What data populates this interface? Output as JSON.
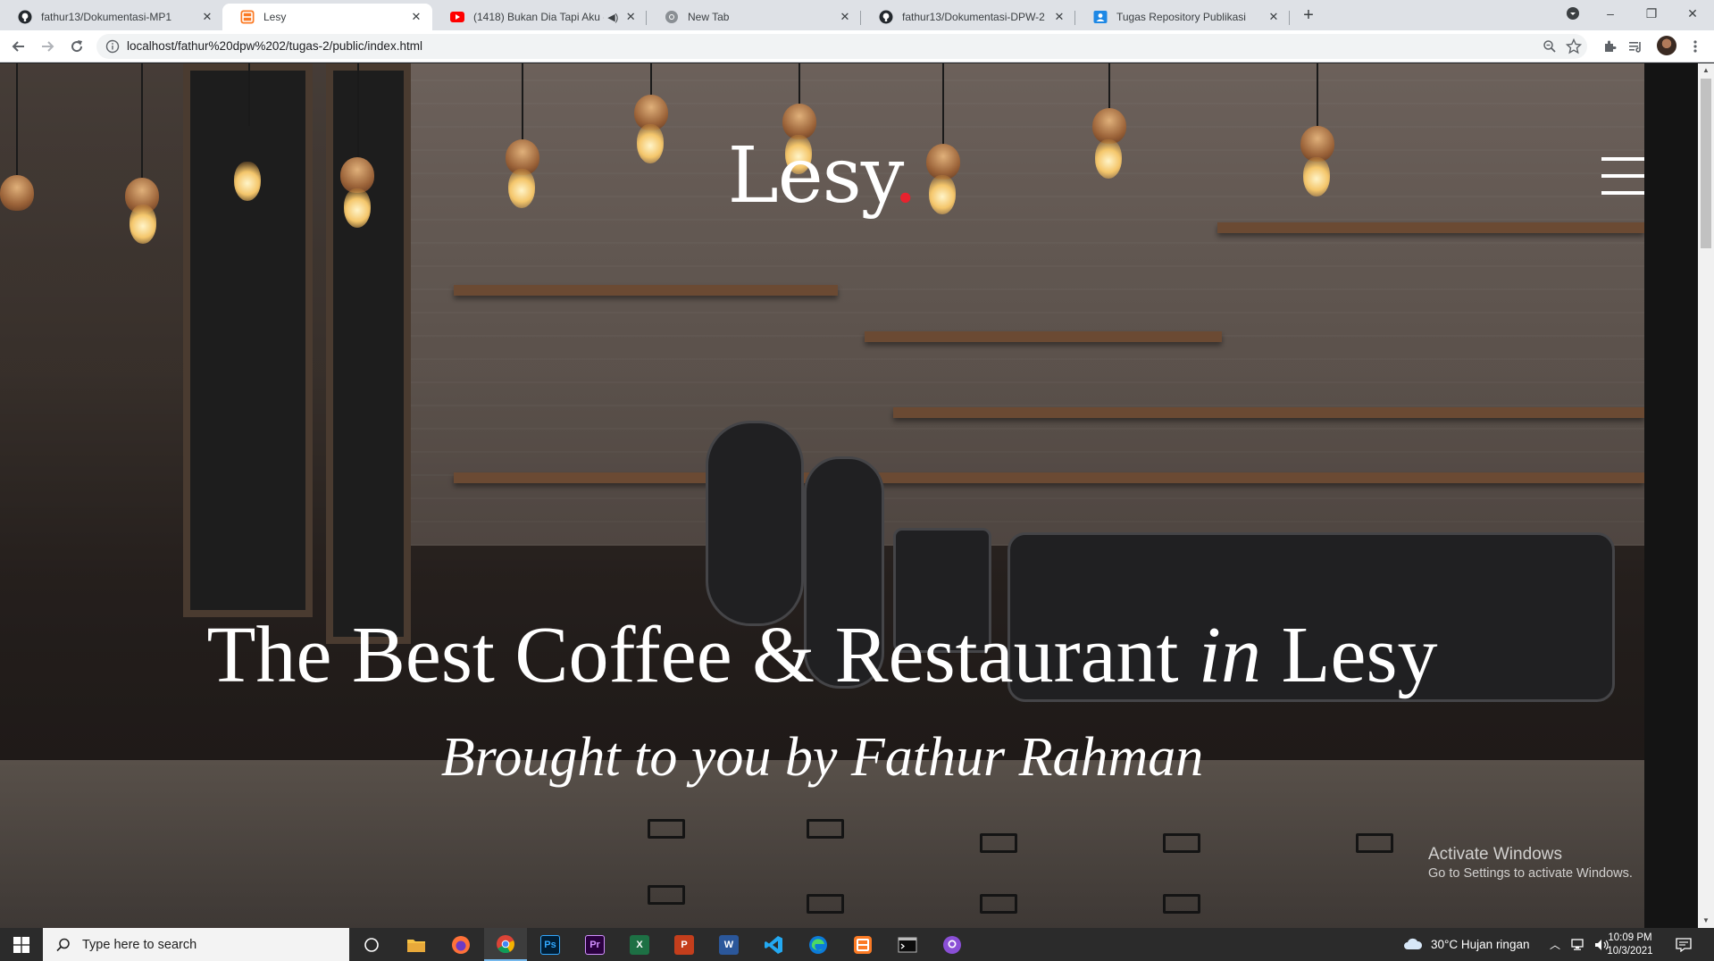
{
  "browser": {
    "tabs": [
      {
        "title": "fathur13/Dokumentasi-MP1",
        "icon": "github-icon",
        "active": false
      },
      {
        "title": "Lesy",
        "icon": "site-favicon-icon",
        "active": true
      },
      {
        "title": "(1418) Bukan Dia Tapi Aku -",
        "icon": "youtube-icon",
        "active": false,
        "audio": true
      },
      {
        "title": "New Tab",
        "icon": "chrome-icon",
        "active": false
      },
      {
        "title": "fathur13/Dokumentasi-DPW-2",
        "icon": "github-icon",
        "active": false
      },
      {
        "title": "Tugas Repository Publikasi",
        "icon": "google-classroom-icon",
        "active": false
      }
    ],
    "new_tab_symbol": "+",
    "window_controls": {
      "minimize": "–",
      "maximize": "❐",
      "close": "✕"
    },
    "url": "localhost/fathur%20dpw%202/tugas-2/public/index.html"
  },
  "page": {
    "logo_text": "Lesy",
    "logo_dot": ".",
    "headline_part1": "The Best Coffee & Restaurant",
    "headline_italic": "in",
    "headline_part2": "Lesy",
    "tagline": "Brought to you by Fathur Rahman",
    "accent_color": "#e8222e"
  },
  "watermark": {
    "line1": "Activate Windows",
    "line2": "Go to Settings to activate Windows."
  },
  "taskbar": {
    "search_placeholder": "Type here to search",
    "apps": [
      "cortana-icon",
      "file-explorer-icon",
      "firefox-icon",
      "chrome-icon",
      "photoshop-icon",
      "premiere-icon",
      "excel-icon",
      "powerpoint-icon",
      "word-icon",
      "vscode-icon",
      "edge-icon",
      "xampp-icon",
      "terminal-icon",
      "github-desktop-icon"
    ],
    "weather": "30°C  Hujan ringan",
    "time": "10:09 PM",
    "date": "10/3/2021"
  }
}
